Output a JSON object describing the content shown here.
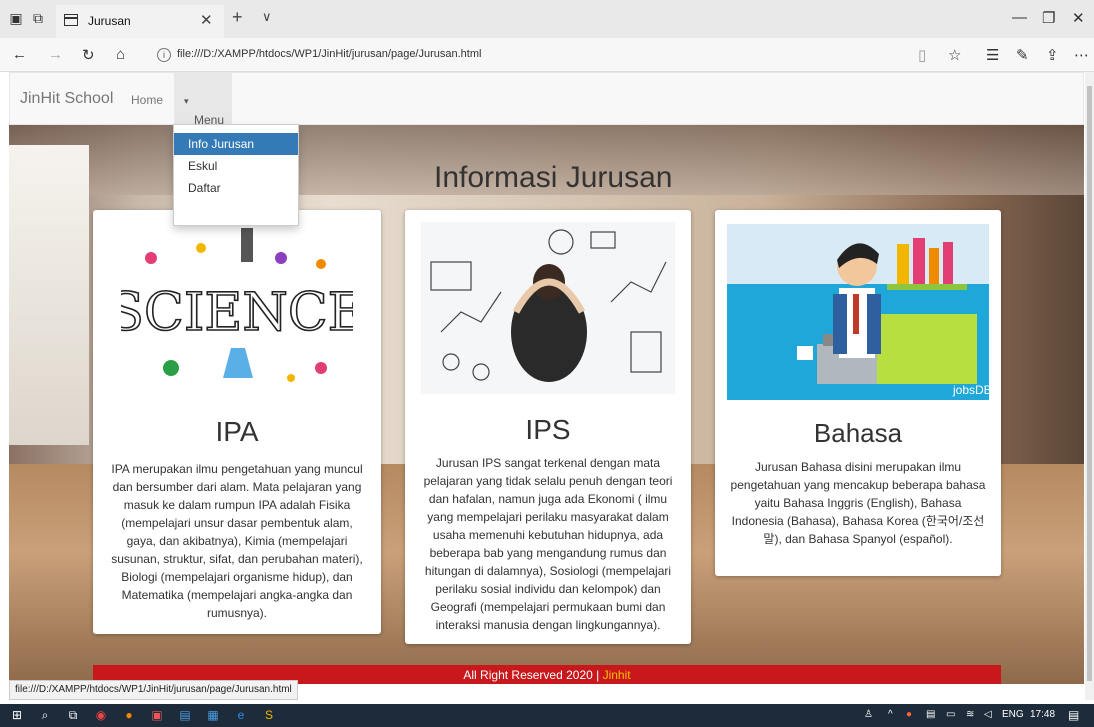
{
  "browser": {
    "tab_title": "Jurusan",
    "url": "file:///D:/XAMPP/htdocs/WP1/JinHit/jurusan/page/Jurusan.html",
    "status_url": "file:///D:/XAMPP/htdocs/WP1/JinHit/jurusan/page/Jurusan.html"
  },
  "navbar": {
    "brand": "JinHit School",
    "home": "Home",
    "menu": "Menu",
    "dropdown": [
      "Info Jurusan",
      "Eskul",
      "Daftar"
    ]
  },
  "heading": "Informasi Jurusan",
  "cards": [
    {
      "title": "IPA",
      "image_text": "SCIENCE",
      "body": "IPA merupakan ilmu pengetahuan yang muncul dan bersumber dari alam. Mata pelajaran yang masuk ke dalam rumpun IPA adalah Fisika (mempelajari unsur dasar pembentuk alam, gaya, dan akibatnya), Kimia (mempelajari susunan, struktur, sifat, dan perubahan materi), Biologi (mempelajari organisme hidup), dan Matematika (mempelajari angka-angka dan rumusnya)."
    },
    {
      "title": "IPS",
      "body": "Jurusan IPS sangat terkenal dengan mata pelajaran yang tidak selalu penuh dengan teori dan hafalan, namun juga ada Ekonomi ( ilmu yang mempelajari perilaku masyarakat dalam usaha memenuhi kebutuhan hidupnya, ada beberapa bab yang mengandung rumus dan hitungan di dalamnya), Sosiologi (mempelajari perilaku sosial individu dan kelompok) dan Geografi (mempelajari permukaan bumi dan interaksi manusia dengan lingkungannya)."
    },
    {
      "title": "Bahasa",
      "image_text": "jobsDB",
      "body": "Jurusan Bahasa disini merupakan ilmu pengetahuan yang mencakup beberapa bahasa yaitu Bahasa Inggris (English), Bahasa Indonesia (Bahasa), Bahasa Korea (한국어/조선말), dan Bahasa Spanyol (español)."
    }
  ],
  "footer": {
    "text": "All Right Reserved 2020 |",
    "link": "Jinhit"
  },
  "taskbar": {
    "lang": "ENG",
    "time": "17:48"
  },
  "colors": {
    "footer_bg": "#c9181b",
    "dropdown_active": "#337ab7",
    "footer_link": "#f2c200"
  }
}
